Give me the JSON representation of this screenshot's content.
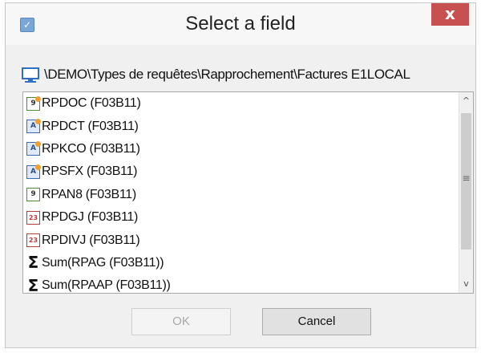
{
  "window": {
    "title": "Select a field",
    "close_label": "x"
  },
  "path": {
    "text": "\\DEMO\\Types de requêtes\\Rapprochement\\Factures E1LOCAL",
    "icon": "computer-monitor-icon"
  },
  "fields": [
    {
      "label": "RPDOC (F03B11)",
      "icon": "numeric-calculated-icon",
      "icon_text": "9"
    },
    {
      "label": "RPDCT (F03B11)",
      "icon": "alpha-icon",
      "icon_text": "A"
    },
    {
      "label": "RPKCO (F03B11)",
      "icon": "alpha-icon",
      "icon_text": "A"
    },
    {
      "label": "RPSFX (F03B11)",
      "icon": "alpha-icon",
      "icon_text": "A"
    },
    {
      "label": "RPAN8 (F03B11)",
      "icon": "numeric-icon",
      "icon_text": "9"
    },
    {
      "label": "RPDGJ (F03B11)",
      "icon": "date-icon",
      "icon_text": "23"
    },
    {
      "label": "RPDIVJ (F03B11)",
      "icon": "date-icon",
      "icon_text": "23"
    },
    {
      "label": "Sum(RPAG (F03B11))",
      "icon": "sum-icon",
      "icon_text": "Σ"
    },
    {
      "label": "Sum(RPAAP (F03B11))",
      "icon": "sum-icon",
      "icon_text": "Σ"
    }
  ],
  "scrollbar": {
    "up_glyph": "^",
    "down_glyph": "v",
    "grip_glyph": "≡"
  },
  "buttons": {
    "ok_label": "OK",
    "cancel_label": "Cancel"
  },
  "colors": {
    "close_button": "#c75050",
    "dialog_background": "#f0f0f0"
  }
}
